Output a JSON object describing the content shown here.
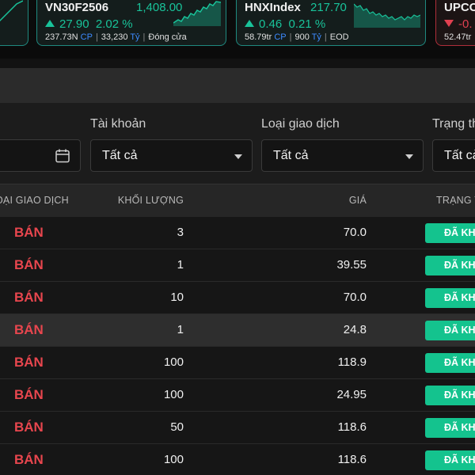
{
  "tickers": [
    {
      "name": "VN30F2506",
      "price": "1,408.00",
      "change": "27.90",
      "change_pct": "2.02 %",
      "volume": "237.73N",
      "volume_unit": "CP",
      "value": "33,230",
      "value_unit": "Tỷ",
      "status": "Đóng cửa",
      "direction": "up"
    },
    {
      "name": "HNXIndex",
      "price": "217.70",
      "change": "0.46",
      "change_pct": "0.21 %",
      "volume": "58.79tr",
      "volume_unit": "CP",
      "value": "900",
      "value_unit": "Tỷ",
      "status": "EOD",
      "direction": "up"
    },
    {
      "name": "UPCO",
      "change": "-0.",
      "volume": "52.47tr",
      "direction": "down"
    }
  ],
  "filters": {
    "account_label": "Tài khoản",
    "account_value": "Tất cả",
    "type_label": "Loại giao dịch",
    "type_value": "Tất cả",
    "status_label": "Trạng th",
    "status_value": "Tất cả"
  },
  "table": {
    "headers": {
      "type": "OẠI GIAO DỊCH",
      "quantity": "KHỐI LƯỢNG",
      "price": "GIÁ",
      "status": "TRẠNG T"
    },
    "rows": [
      {
        "side": "BÁN",
        "quantity": "3",
        "price": "70.0",
        "status": "ĐÃ KHO"
      },
      {
        "side": "BÁN",
        "quantity": "1",
        "price": "39.55",
        "status": "ĐÃ KHO"
      },
      {
        "side": "BÁN",
        "quantity": "10",
        "price": "70.0",
        "status": "ĐÃ KHO"
      },
      {
        "side": "BÁN",
        "quantity": "1",
        "price": "24.8",
        "status": "ĐÃ KHO"
      },
      {
        "side": "BÁN",
        "quantity": "100",
        "price": "118.9",
        "status": "ĐÃ KHO"
      },
      {
        "side": "BÁN",
        "quantity": "100",
        "price": "24.95",
        "status": "ĐÃ KHO"
      },
      {
        "side": "BÁN",
        "quantity": "50",
        "price": "118.6",
        "status": "ĐÃ KHO"
      },
      {
        "side": "BÁN",
        "quantity": "100",
        "price": "118.6",
        "status": "ĐÃ KHO"
      }
    ]
  },
  "colors": {
    "up": "#19c39a",
    "down": "#e04050",
    "sell_text": "#e8464e",
    "status_badge": "#14c38e"
  }
}
